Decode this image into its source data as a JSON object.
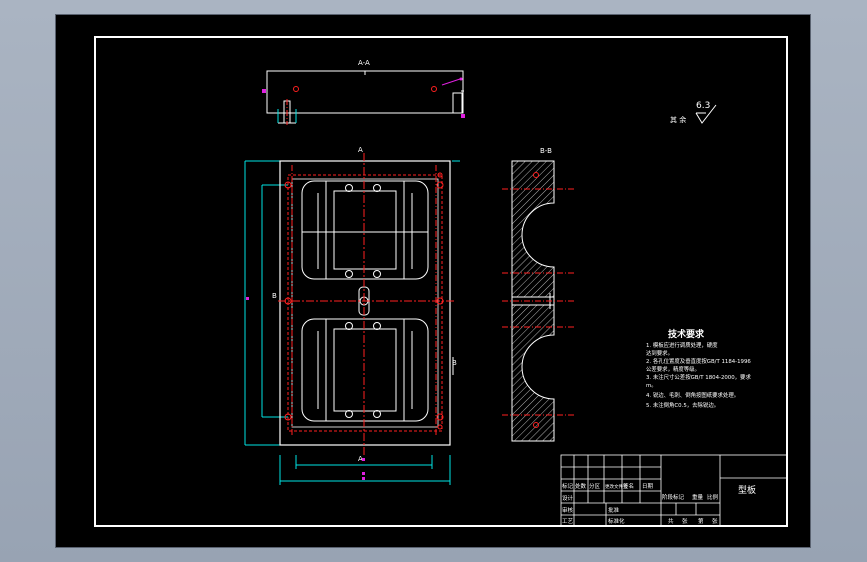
{
  "drawing": {
    "surface_roughness": "6.3",
    "roughness_prefix": "其 余",
    "section_label_top": "A-A",
    "section_label_side": "B-B",
    "cut_marker_a": "A",
    "cut_marker_b": "B",
    "tech_requirements": {
      "heading": "技术要求",
      "items": [
        "1. 模板应进行调质处理，硬度",
        "    达到要求。",
        "2. 各孔位置度及垂直度按GB/T 1184-1996",
        "    公差要求，精度等级。",
        "3. 未注尺寸公差按GB/T 1804-2000，要求",
        "    m。",
        "4. 锐边、毛刺、倒角按图纸要求处理。",
        "5. 未注倒角C0.5，去除锐边。"
      ]
    },
    "title_block": {
      "part_name": "型板",
      "row_labels": [
        "标记",
        "设计",
        "审核",
        "工艺"
      ],
      "col_labels": [
        "处数",
        "分区",
        "更改文件号",
        "签名",
        "日期"
      ],
      "sub_labels": [
        "标准化",
        "阶段标记",
        "重量",
        "比例"
      ],
      "bottom_labels": [
        "批准",
        "共",
        "张",
        "第",
        "张"
      ]
    },
    "colors": {
      "outline": "#ffffff",
      "center_line": "#ff2020",
      "dimension": "#00e5e5",
      "hatch": "#ffffff",
      "annotation": "#e020e0"
    }
  }
}
